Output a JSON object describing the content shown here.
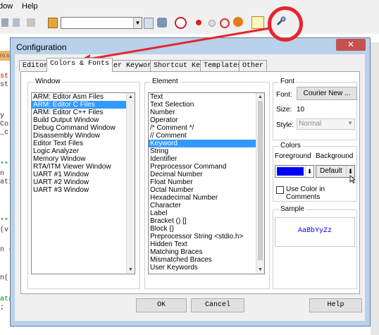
{
  "app": {
    "menu": [
      "dow",
      "Help"
    ],
    "editor_fragments": [
      "st",
      "st",
      "y",
      "Co",
      "_c",
      "**",
      "n",
      "ati",
      "**",
      "(v",
      "n (",
      "n(",
      "ata",
      ";"
    ],
    "tab_fragment": "ro.s"
  },
  "dialog": {
    "title": "Configuration",
    "close_glyph": "✕",
    "tabs": [
      "Editor",
      "Colors & Fonts",
      "User Keywords",
      "Shortcut Keys",
      "Templates",
      "Other"
    ],
    "active_tab": "Colors & Fonts",
    "window_group": {
      "label": "Window",
      "items": [
        "ARM: Editor Asm Files",
        "ARM: Editor C Files",
        "ARM: Editor C++ Files",
        "Build Output Window",
        "Debug Command Window",
        "Disassembly Window",
        "Editor Text Files",
        "Logic Analyzer",
        "Memory Window",
        "RTA/ITM Viewer Window",
        "UART #1 Window",
        "UART #2 Window",
        "UART #3 Window"
      ],
      "selected": "ARM: Editor C Files"
    },
    "element_group": {
      "label": "Element",
      "items": [
        "Text",
        "Text Selection",
        "Number",
        "Operator",
        "/* Comment */",
        "// Comment",
        "Keyword",
        "String",
        "Identifier",
        "Preprocessor Command",
        "Decimal Number",
        "Float Number",
        "Octal Number",
        "Hexadecimal Number",
        "Character",
        "Label",
        "Bracket () []",
        "Block {}",
        "Preprocessor String <stdio.h>",
        "Hidden Text",
        "Matching Braces",
        "Mismatched Braces",
        "User Keywords"
      ],
      "selected": "Keyword"
    },
    "font_group": {
      "label": "Font",
      "font_label": "Font:",
      "font_value": "Courier New ...",
      "size_label": "Size:",
      "size_value": "10",
      "style_label": "Style:",
      "style_value": "Normal"
    },
    "colors_group": {
      "label": "Colors",
      "foreground_label": "Foreground",
      "background_label": "Background",
      "foreground_color": "#0000ff",
      "background_value": "Default",
      "use_color_label": "Use Color in Comments",
      "use_color_checked": false
    },
    "sample_group": {
      "label": "Sample",
      "text": "AaBbYyZz",
      "text_color": "#0000ff"
    },
    "buttons": {
      "ok": "OK",
      "cancel": "Cancel",
      "help": "Help"
    }
  },
  "annotation": {
    "color": "#e8242c"
  }
}
